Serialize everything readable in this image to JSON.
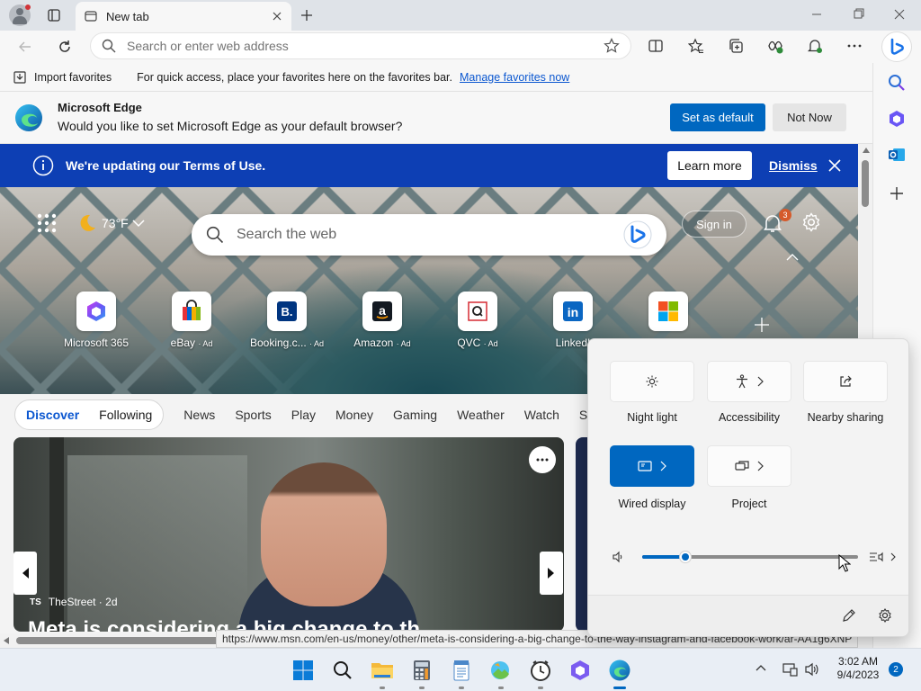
{
  "browser": {
    "tab_title": "New tab",
    "address_placeholder": "Search or enter web address"
  },
  "favorites_bar": {
    "import_label": "Import favorites",
    "hint": "For quick access, place your favorites here on the favorites bar.",
    "manage_link": "Manage favorites now"
  },
  "default_prompt": {
    "title": "Microsoft Edge",
    "message": "Would you like to set Microsoft Edge as your default browser?",
    "set_default": "Set as default",
    "not_now": "Not Now"
  },
  "terms_banner": {
    "message": "We're updating our Terms of Use.",
    "learn_more": "Learn more",
    "dismiss": "Dismiss"
  },
  "newtab": {
    "weather": "73°F",
    "search_placeholder": "Search the web",
    "sign_in": "Sign in",
    "notification_count": "3",
    "tiles": [
      {
        "label": "Microsoft 365",
        "ad": ""
      },
      {
        "label": "eBay",
        "ad": "· Ad"
      },
      {
        "label": "Booking.c...",
        "ad": "· Ad"
      },
      {
        "label": "Amazon",
        "ad": "· Ad"
      },
      {
        "label": "QVC",
        "ad": "· Ad"
      },
      {
        "label": "LinkedI",
        "ad": ""
      }
    ]
  },
  "feed": {
    "pill_tabs": [
      "Discover",
      "Following"
    ],
    "nav": [
      "News",
      "Sports",
      "Play",
      "Money",
      "Gaming",
      "Weather",
      "Watch",
      "S"
    ],
    "card": {
      "source_logo": "TS",
      "source": "TheStreet · 2d",
      "headline": "Meta is considering a big change to th"
    }
  },
  "status_url": "https://www.msn.com/en-us/money/other/meta-is-considering-a-big-change-to-the-way-instagram-and-facebook-work/ar-AA1g6XNP",
  "quick_settings": {
    "tiles": [
      {
        "label": "Night light",
        "active": false
      },
      {
        "label": "Accessibility",
        "active": false
      },
      {
        "label": "Nearby sharing",
        "active": false
      },
      {
        "label": "Wired display",
        "active": true
      },
      {
        "label": "Project",
        "active": false
      }
    ],
    "volume_level": 0.2,
    "accent": "#0067c0"
  },
  "taskbar": {
    "time": "3:02 AM",
    "date": "9/4/2023",
    "notification_count": "2",
    "apps": [
      "windows-start-icon",
      "search-icon",
      "file-explorer-icon",
      "calculator-icon",
      "notepad-icon",
      "photos-icon",
      "clock-icon",
      "microsoft-365-icon",
      "edge-icon"
    ]
  }
}
